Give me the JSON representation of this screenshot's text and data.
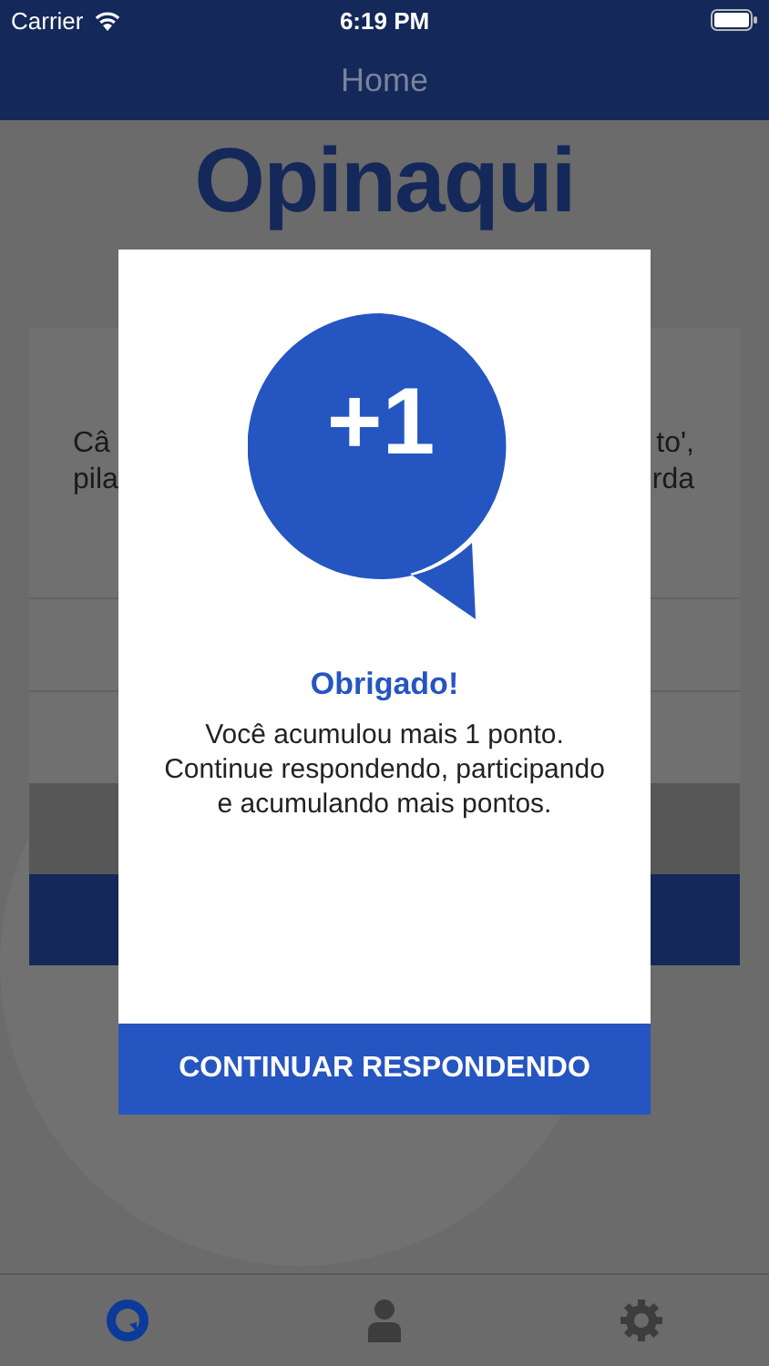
{
  "status_bar": {
    "carrier": "Carrier",
    "time": "6:19 PM"
  },
  "nav_bar": {
    "title": "Home"
  },
  "logo": {
    "text": "Opinaqui"
  },
  "question_card": {
    "lines": [
      {
        "left": "Câ",
        "right": "to',"
      },
      {
        "left": "pila",
        "right": "rda"
      }
    ]
  },
  "modal": {
    "badge": "+1",
    "title": "Obrigado!",
    "message": "Você acumulou mais 1 ponto. Continue respondendo, participando e acumulando mais pontos.",
    "button": "CONTINUAR RESPONDENDO"
  },
  "tab_bar": [
    {
      "kind": "home",
      "selected": true
    },
    {
      "kind": "profile",
      "selected": false
    },
    {
      "kind": "settings",
      "selected": false
    }
  ]
}
